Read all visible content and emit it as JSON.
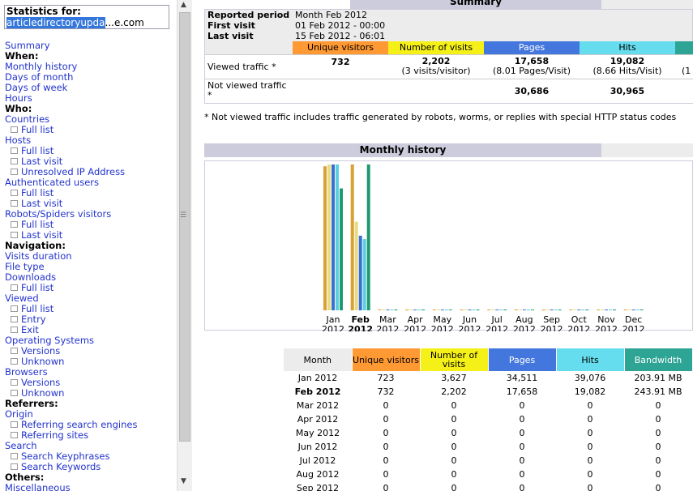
{
  "sidebar": {
    "stats_label": "Statistics for:",
    "domain_selected": "articledirectoryupda",
    "domain_rest": "...e.com",
    "items": [
      {
        "label": "Summary",
        "type": "link"
      },
      {
        "label": "When:",
        "type": "heading"
      },
      {
        "label": "Monthly history",
        "type": "link"
      },
      {
        "label": "Days of month",
        "type": "link"
      },
      {
        "label": "Days of week",
        "type": "link"
      },
      {
        "label": "Hours",
        "type": "link"
      },
      {
        "label": "Who:",
        "type": "heading"
      },
      {
        "label": "Countries",
        "type": "link"
      },
      {
        "label": "Full list",
        "type": "sub"
      },
      {
        "label": "Hosts",
        "type": "link"
      },
      {
        "label": "Full list",
        "type": "sub"
      },
      {
        "label": "Last visit",
        "type": "sub"
      },
      {
        "label": "Unresolved IP Address",
        "type": "sub"
      },
      {
        "label": "Authenticated users",
        "type": "link"
      },
      {
        "label": "Full list",
        "type": "sub"
      },
      {
        "label": "Last visit",
        "type": "sub"
      },
      {
        "label": "Robots/Spiders visitors",
        "type": "link"
      },
      {
        "label": "Full list",
        "type": "sub"
      },
      {
        "label": "Last visit",
        "type": "sub"
      },
      {
        "label": "Navigation:",
        "type": "heading"
      },
      {
        "label": "Visits duration",
        "type": "link"
      },
      {
        "label": "File type",
        "type": "link"
      },
      {
        "label": "Downloads",
        "type": "link"
      },
      {
        "label": "Full list",
        "type": "sub"
      },
      {
        "label": "Viewed",
        "type": "link"
      },
      {
        "label": "Full list",
        "type": "sub"
      },
      {
        "label": "Entry",
        "type": "sub"
      },
      {
        "label": "Exit",
        "type": "sub"
      },
      {
        "label": "Operating Systems",
        "type": "link"
      },
      {
        "label": "Versions",
        "type": "sub"
      },
      {
        "label": "Unknown",
        "type": "sub"
      },
      {
        "label": "Browsers",
        "type": "link"
      },
      {
        "label": "Versions",
        "type": "sub"
      },
      {
        "label": "Unknown",
        "type": "sub"
      },
      {
        "label": "Referrers:",
        "type": "heading"
      },
      {
        "label": "Origin",
        "type": "link"
      },
      {
        "label": "Referring search engines",
        "type": "sub"
      },
      {
        "label": "Referring sites",
        "type": "sub"
      },
      {
        "label": "Search",
        "type": "link"
      },
      {
        "label": "Search Keyphrases",
        "type": "sub"
      },
      {
        "label": "Search Keywords",
        "type": "sub"
      },
      {
        "label": "Others:",
        "type": "heading"
      },
      {
        "label": "Miscellaneous",
        "type": "link"
      }
    ]
  },
  "summary": {
    "title": "Summary",
    "reported_period_label": "Reported period",
    "reported_period_value": "Month Feb 2012",
    "first_visit_label": "First visit",
    "first_visit_value": "01 Feb 2012 - 00:00",
    "last_visit_label": "Last visit",
    "last_visit_value": "15 Feb 2012 - 06:01",
    "headers": {
      "unique": "Unique visitors",
      "visits": "Number of visits",
      "pages": "Pages",
      "hits": "Hits"
    },
    "viewed_label": "Viewed traffic *",
    "viewed": {
      "unique": "732",
      "visits": "2,202",
      "visits_sub": "(3 visits/visitor)",
      "pages": "17,658",
      "pages_sub": "(8.01 Pages/Visit)",
      "hits": "19,082",
      "hits_sub": "(8.66 Hits/Visit)",
      "bw_sub": "(1"
    },
    "notviewed_label": "Not viewed traffic *",
    "notviewed": {
      "pages": "30,686",
      "hits": "30,965"
    },
    "note": "* Not viewed traffic includes traffic generated by robots, worms, or replies with special HTTP status codes"
  },
  "monthly": {
    "title": "Monthly history",
    "headers": {
      "month": "Month",
      "unique": "Unique visitors",
      "visits": "Number of visits",
      "pages": "Pages",
      "hits": "Hits",
      "bandwidth": "Bandwidth"
    },
    "rows": [
      {
        "month": "Jan 2012",
        "unique": "723",
        "visits": "3,627",
        "pages": "34,511",
        "hits": "39,076",
        "bandwidth": "203.91 MB"
      },
      {
        "month": "Feb 2012",
        "unique": "732",
        "visits": "2,202",
        "pages": "17,658",
        "hits": "19,082",
        "bandwidth": "243.91 MB",
        "current": true
      },
      {
        "month": "Mar 2012",
        "unique": "0",
        "visits": "0",
        "pages": "0",
        "hits": "0",
        "bandwidth": "0"
      },
      {
        "month": "Apr 2012",
        "unique": "0",
        "visits": "0",
        "pages": "0",
        "hits": "0",
        "bandwidth": "0"
      },
      {
        "month": "May 2012",
        "unique": "0",
        "visits": "0",
        "pages": "0",
        "hits": "0",
        "bandwidth": "0"
      },
      {
        "month": "Jun 2012",
        "unique": "0",
        "visits": "0",
        "pages": "0",
        "hits": "0",
        "bandwidth": "0"
      },
      {
        "month": "Jul 2012",
        "unique": "0",
        "visits": "0",
        "pages": "0",
        "hits": "0",
        "bandwidth": "0"
      },
      {
        "month": "Aug 2012",
        "unique": "0",
        "visits": "0",
        "pages": "0",
        "hits": "0",
        "bandwidth": "0"
      },
      {
        "month": "Sep 2012",
        "unique": "0",
        "visits": "0",
        "pages": "0",
        "hits": "0",
        "bandwidth": "0"
      }
    ]
  },
  "chart_data": {
    "type": "bar",
    "categories": [
      {
        "m": "Jan",
        "y": "2012"
      },
      {
        "m": "Feb",
        "y": "2012",
        "current": true
      },
      {
        "m": "Mar",
        "y": "2012"
      },
      {
        "m": "Apr",
        "y": "2012"
      },
      {
        "m": "May",
        "y": "2012"
      },
      {
        "m": "Jun",
        "y": "2012"
      },
      {
        "m": "Jul",
        "y": "2012"
      },
      {
        "m": "Aug",
        "y": "2012"
      },
      {
        "m": "Sep",
        "y": "2012"
      },
      {
        "m": "Oct",
        "y": "2012"
      },
      {
        "m": "Nov",
        "y": "2012"
      },
      {
        "m": "Dec",
        "y": "2012"
      }
    ],
    "series": [
      {
        "key": "unique",
        "color": "#d8a035",
        "values": [
          723,
          732,
          0,
          0,
          0,
          0,
          0,
          0,
          0,
          0,
          0,
          0
        ]
      },
      {
        "key": "visits",
        "color": "#e8dc80",
        "values": [
          3627,
          2202,
          0,
          0,
          0,
          0,
          0,
          0,
          0,
          0,
          0,
          0
        ]
      },
      {
        "key": "pages",
        "color": "#3a6fd0",
        "values": [
          34511,
          17658,
          0,
          0,
          0,
          0,
          0,
          0,
          0,
          0,
          0,
          0
        ]
      },
      {
        "key": "hits",
        "color": "#58d0e0",
        "values": [
          39076,
          19082,
          0,
          0,
          0,
          0,
          0,
          0,
          0,
          0,
          0,
          0
        ]
      },
      {
        "key": "bandwidth",
        "color": "#1e9a70",
        "values": [
          203.91,
          243.91,
          0,
          0,
          0,
          0,
          0,
          0,
          0,
          0,
          0,
          0
        ]
      }
    ]
  }
}
